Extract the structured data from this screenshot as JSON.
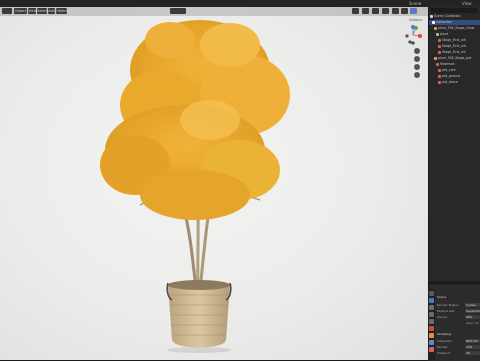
{
  "header": {
    "scene": "Scene",
    "view_layer": "View Layer"
  },
  "viewport": {
    "mode_buttons": [
      "Object",
      "View",
      "Select",
      "Add",
      "Object"
    ],
    "shading_label": "Options",
    "gizmo_axes": {
      "x_color": "#e8414e",
      "y_color": "#6ea33b",
      "z_color": "#3f7fe6"
    }
  },
  "outliner": {
    "rows": [
      {
        "label": "Scene Collection",
        "icon": "collection-icon",
        "color": "#cfcfcf"
      },
      {
        "label": "Collection",
        "icon": "collection-icon",
        "color": "#ffffff"
      },
      {
        "label": "plant_TAK_Stage_Grow",
        "icon": "object-icon",
        "color": "#e0a050"
      },
      {
        "label": "plant",
        "icon": "mesh-icon",
        "color": "#9acd6a"
      },
      {
        "label": "Stage_First_wh",
        "icon": "material-icon",
        "color": "#d96060"
      },
      {
        "label": "Stage_First_wh",
        "icon": "material-icon",
        "color": "#d96060"
      },
      {
        "label": "Stage_First_wh",
        "icon": "material-icon",
        "color": "#d96060"
      },
      {
        "label": "plant_TAK_Stage_pot",
        "icon": "object-icon",
        "color": "#e0a050"
      },
      {
        "label": "Materials",
        "icon": "material-icon",
        "color": "#d96060"
      },
      {
        "label": "pot_core",
        "icon": "material-icon",
        "color": "#d96060"
      },
      {
        "label": "pot_ground",
        "icon": "material-icon",
        "color": "#d96060"
      },
      {
        "label": "pot_stone",
        "icon": "material-icon",
        "color": "#d96060"
      }
    ]
  },
  "properties": {
    "panel_title": "Scene",
    "rows": [
      {
        "label": "Render Engine",
        "value": "Cycles"
      },
      {
        "label": "Feature Set",
        "value": "Supported"
      },
      {
        "label": "Device",
        "value": "GPU"
      },
      {
        "label": "",
        "value": "Open Sh"
      }
    ],
    "section": "Sampling",
    "sampling_rows": [
      {
        "label": "Integrator",
        "value": "Path Tra"
      },
      {
        "label": "Render",
        "value": "128"
      },
      {
        "label": "Viewport",
        "value": "32"
      }
    ]
  }
}
